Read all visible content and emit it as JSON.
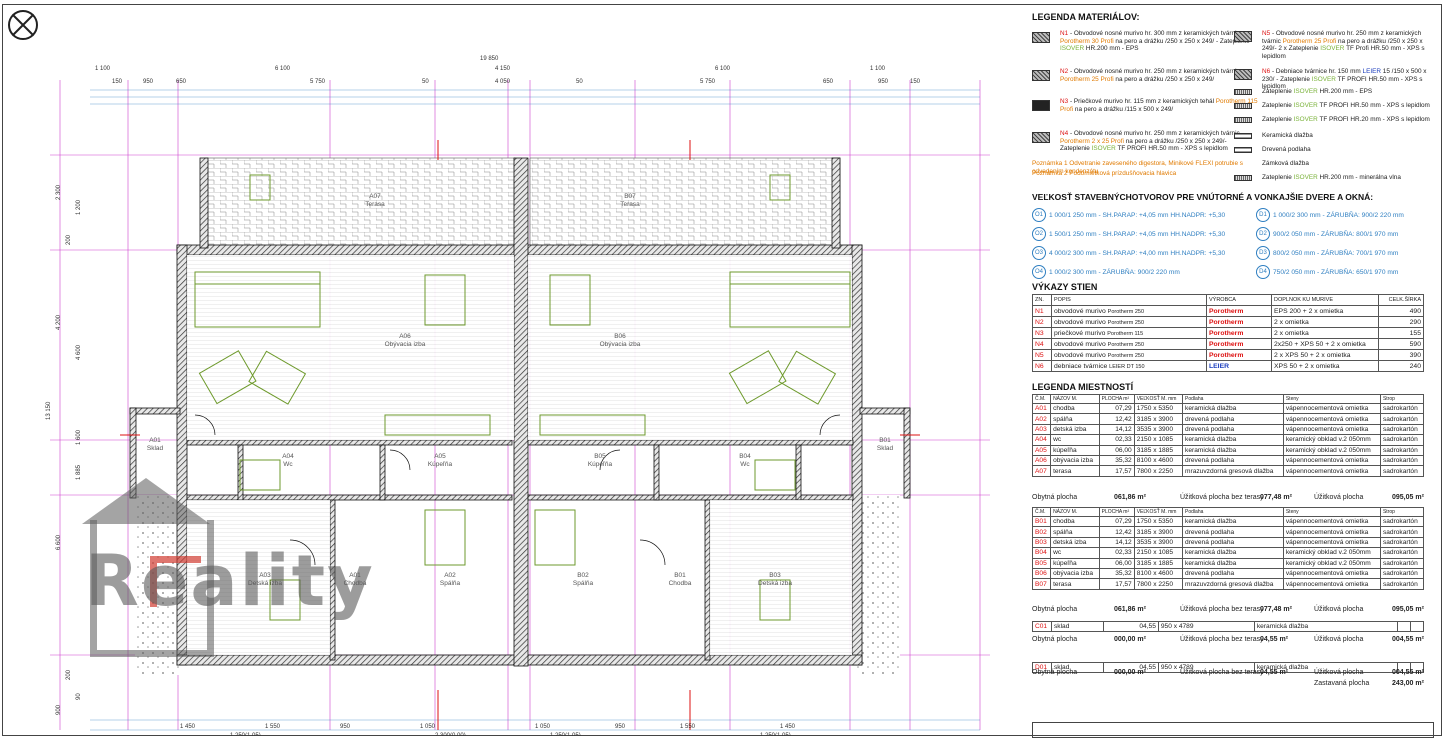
{
  "drawing": {
    "dims_top": [
      "19 850",
      "1 100",
      "6 100",
      "4 150",
      "6 100",
      "1 100",
      "150",
      "950",
      "650",
      "5 750",
      "50",
      "4 050",
      "50",
      "5 750",
      "650",
      "950",
      "150"
    ],
    "dims_left": [
      "2 300",
      "200",
      "1 200",
      "4 200",
      "4 600",
      "13 150",
      "1 600",
      "1 885",
      "6 600",
      "200",
      "90",
      "900"
    ],
    "dims_bottom": [
      "1 450",
      "1 550",
      "950",
      "1 050",
      "1 050",
      "950",
      "1 550",
      "1 450",
      "1 250(1,05)",
      "2 300(0,00)",
      "1 250(1,05)",
      "1 250(1,05)"
    ],
    "rooms": [
      {
        "code": "A07",
        "name": "Terasa"
      },
      {
        "code": "B07",
        "name": "Terasa"
      },
      {
        "code": "A06",
        "name": "Obývacia izba"
      },
      {
        "code": "B06",
        "name": "Obývacia izba"
      },
      {
        "code": "A05",
        "name": "Kúpeľňa"
      },
      {
        "code": "B05",
        "name": "Kúpeľňa"
      },
      {
        "code": "A04",
        "name": "Wc"
      },
      {
        "code": "B04",
        "name": "Wc"
      },
      {
        "code": "A01",
        "name": "Sklad"
      },
      {
        "code": "B01",
        "name": "Sklad"
      },
      {
        "code": "A03",
        "name": "Detská izba"
      },
      {
        "code": "B03",
        "name": "Detská izba"
      },
      {
        "code": "A02",
        "name": "Spálňa"
      },
      {
        "code": "B02",
        "name": "Spálňa"
      },
      {
        "code": "A01",
        "name": "Chodba"
      },
      {
        "code": "B01",
        "name": "Chodba"
      }
    ],
    "watermark": "Reality"
  },
  "legend_materials": {
    "title": "LEGENDA MATERIÁLOV:",
    "items_left": [
      {
        "code": "N1",
        "text": "- Obvodové nosné murivo hr. 300 mm z keramických tvárnic Porotherm 30 Profi na pero a drážku /250 x 250 x 249/ - Zateplenie ISOVER HR.200 mm - EPS"
      },
      {
        "code": "N2",
        "text": "- Obvodové nosné murivo hr. 250 mm z keramických tvárnic Porotherm 25 Profi na pero a drážku /250 x 250 x 249/"
      },
      {
        "code": "N3",
        "text": "- Priečkové murivo hr. 115 mm z keramických tehál Porotherm 115 Profi na pero a drážku /115 x 500 x 249/"
      },
      {
        "code": "N4",
        "text": "- Obvodové nosné murivo hr. 250 mm z keramických tvárnic Porotherm 2 x 25 Profi na pero a drážku /250 x 250 x 249/- Zateplenie ISOVER TF PROFI HR.50 mm - XPS s lepidlom"
      }
    ],
    "notes": [
      {
        "label": "Poznámka 1",
        "text": "Odvetranie zaveseného digestora, Minikové FLEXI potrubie s odvedením kondenzátu"
      },
      {
        "label": "Poznámka 2",
        "text": "Podomietková prízdušňovacia hlavica"
      }
    ],
    "items_right": [
      {
        "code": "N5",
        "text": "- Obvodové nosné murivo hr. 250 mm z keramických tvárnic Porotherm 25 Profi na pero a drážku /250 x 250 x 249/- 2 x Zateplenie ISOVER TF Profi HR.50 mm - XPS s lepidlom"
      },
      {
        "code": "N6",
        "text": "- Debniace tvárnice hr. 150 mm LEIER 15 /150 x 500 x 230/ - Zateplenie ISOVER TF PROFI HR.50 mm - XPS s lepidlom"
      },
      {
        "code": "",
        "text": "Zateplenie ISOVER HR.200 mm - EPS"
      },
      {
        "code": "",
        "text": "Zateplenie ISOVER TF PROFI HR.50 mm - XPS s lepidlom"
      },
      {
        "code": "",
        "text": "Zateplenie ISOVER TF PROFI HR.20 mm - XPS s lepidlom"
      },
      {
        "code": "",
        "text": "Keramická dlažba"
      },
      {
        "code": "",
        "text": "Drevená podlaha"
      },
      {
        "code": "",
        "text": "Zámková dlažba"
      },
      {
        "code": "",
        "text": "Zateplenie ISOVER HR.200 mm - minerálna vlna"
      }
    ]
  },
  "openings": {
    "title": "VEĽKOSŤ STAVEBNÝCHOTVOROV  PRE VNÚTORNÉ A VONKAJŠIE DVERE A OKNÁ:",
    "left": [
      {
        "id": "O1",
        "text": "1 000/1 250 mm  -  SH.PARAP:  +4,05 mm HH.NADPR: +5,30"
      },
      {
        "id": "O2",
        "text": "1 500/1 250 mm  -  SH.PARAP:  +4,05 mm HH.NADPR: +5,30"
      },
      {
        "id": "O3",
        "text": "4 000/2 300 mm  -  SH.PARAP:  +4,00 mm HH.NADPR: +5,30"
      },
      {
        "id": "O4",
        "text": "1 000/2 300 mm  -  ZÁRUBŇA:  900/2 220 mm"
      }
    ],
    "right": [
      {
        "id": "D1",
        "text": "1 000/2 300 mm  -  ZÁRUBŇA:  900/2 220 mm"
      },
      {
        "id": "D2",
        "text": "900/2 050 mm  -  ZÁRUBŇA:  800/1 970 mm"
      },
      {
        "id": "D3",
        "text": "800/2 050 mm  -  ZÁRUBŇA:  700/1 970 mm"
      },
      {
        "id": "D4",
        "text": "750/2 050 mm  -  ZÁRUBŇA:  650/1 970 mm"
      }
    ]
  },
  "walls": {
    "title": "VÝKAZY STIEN",
    "headers": [
      "ZN.",
      "POPIS",
      "VÝROBCA",
      "DOPLNOK KU MURIVE",
      "CELK.ŠÍRKA"
    ],
    "rows": [
      {
        "zn": "N1",
        "popis": "obvodové murivo",
        "typ": "Porotherm 250",
        "vyrobca": "Porotherm",
        "doplnok": "EPS 200 + 2 x omietka",
        "sirka": "490"
      },
      {
        "zn": "N2",
        "popis": "obvodové murivo",
        "typ": "Porotherm 250",
        "vyrobca": "Porotherm",
        "doplnok": "2 x omietka",
        "sirka": "290"
      },
      {
        "zn": "N3",
        "popis": "priečkové murivo",
        "typ": "Porotherm 115",
        "vyrobca": "Porotherm",
        "doplnok": "2 x omietka",
        "sirka": "155"
      },
      {
        "zn": "N4",
        "popis": "obvodové murivo",
        "typ": "Porotherm 250",
        "vyrobca": "Porotherm",
        "doplnok": "2x250 + XPS 50 + 2 x omietka",
        "sirka": "590"
      },
      {
        "zn": "N5",
        "popis": "obvodové murivo",
        "typ": "Porotherm 250",
        "vyrobca": "Porotherm",
        "doplnok": "2 x XPS 50 + 2 x omietka",
        "sirka": "390"
      },
      {
        "zn": "N6",
        "popis": "debniace tvárnice",
        "typ": "LEIER DT 150",
        "vyrobca": "LEIER",
        "doplnok": "XPS 50 + 2 x omietka",
        "sirka": "240"
      }
    ]
  },
  "rooms_legend": {
    "title": "LEGENDA MIESTNOSTÍ",
    "headers": [
      "Č.M.",
      "NÁZOV M.",
      "PLOCHA m²",
      "VEĽKOSŤ M. mm",
      "Podlaha",
      "Steny",
      "Strop"
    ],
    "table_a": [
      [
        "A01",
        "chodba",
        "07,29",
        "1750 x 5350",
        "keramická dlažba",
        "vápennocementová omietka",
        "sadrokartón"
      ],
      [
        "A02",
        "spálňa",
        "12,42",
        "3185 x 3900",
        "drevená podlaha",
        "vápennocementová omietka",
        "sadrokartón"
      ],
      [
        "A03",
        "detská izba",
        "14,12",
        "3535 x 3900",
        "drevená podlaha",
        "vápennocementová omietka",
        "sadrokartón"
      ],
      [
        "A04",
        "wc",
        "02,33",
        "2150 x 1085",
        "keramická dlažba",
        "keramický obklad v.2 050mm",
        "sadrokartón"
      ],
      [
        "A05",
        "kúpeľňa",
        "06,00",
        "3185 x 1885",
        "keramická dlažba",
        "keramický obklad v.2 050mm",
        "sadrokartón"
      ],
      [
        "A06",
        "obývacia izba",
        "35,32",
        "8100 x 4600",
        "drevená podlaha",
        "vápennocementová omietka",
        "sadrokartón"
      ],
      [
        "A07",
        "terasa",
        "17,57",
        "7800 x 2250",
        "mrazuvzdorná gresová dlažba",
        "vápennocementová omietka",
        "sadrokartón"
      ]
    ],
    "sum_a": {
      "l1": "Obytná plocha",
      "v1": "061,86 m²",
      "l2": "Úžitková plocha bez terasy",
      "v2": "077,48 m²",
      "l3": "Úžitková plocha",
      "v3": "095,05 m²"
    },
    "table_b": [
      [
        "B01",
        "chodba",
        "07,29",
        "1750 x 5350",
        "keramická dlažba",
        "vápennocementová omietka",
        "sadrokartón"
      ],
      [
        "B02",
        "spálňa",
        "12,42",
        "3185 x 3900",
        "drevená podlaha",
        "vápennocementová omietka",
        "sadrokartón"
      ],
      [
        "B03",
        "detská izba",
        "14,12",
        "3535 x 3900",
        "drevená podlaha",
        "vápennocementová omietka",
        "sadrokartón"
      ],
      [
        "B04",
        "wc",
        "02,33",
        "2150 x 1085",
        "keramická dlažba",
        "keramický obklad v.2 050mm",
        "sadrokartón"
      ],
      [
        "B05",
        "kúpeľňa",
        "06,00",
        "3185 x 1885",
        "keramická dlažba",
        "keramický obklad v.2 050mm",
        "sadrokartón"
      ],
      [
        "B06",
        "obývacia izba",
        "35,32",
        "8100 x 4600",
        "drevená podlaha",
        "vápennocementová omietka",
        "sadrokartón"
      ],
      [
        "B07",
        "terasa",
        "17,57",
        "7800 x 2250",
        "mrazuvzdorná gresová dlažba",
        "vápennocementová omietka",
        "sadrokartón"
      ]
    ],
    "sum_b": {
      "l1": "Obytná plocha",
      "v1": "061,86 m²",
      "l2": "Úžitková plocha bez terasy",
      "v2": "077,48 m²",
      "l3": "Úžitková plocha",
      "v3": "095,05 m²"
    },
    "table_c": [
      [
        "C01",
        "sklad",
        "04,55",
        "950 x 4789",
        "keramická dlažba"
      ]
    ],
    "sum_c": {
      "l1": "Obytná plocha",
      "v1": "000,00 m²",
      "l2": "Úžitková plocha bez terasy",
      "v2": "04,55 m²",
      "l3": "Úžitková plocha",
      "v3": "004,55 m²"
    },
    "table_d": [
      [
        "D01",
        "sklad",
        "04,55",
        "950 x 4789",
        "keramická dlažba"
      ]
    ],
    "sum_d": {
      "l1": "Obytná plocha",
      "v1": "000,00 m²",
      "l2": "Úžitková plocha bez terasy",
      "v2": "04,55 m²",
      "l3": "Úžitková plocha",
      "v3": "004,55 m²",
      "l4": "Zastavaná plocha",
      "v4": "243,00 m²"
    }
  },
  "colors": {
    "accent": "#e07a00",
    "green": "#7ab23a",
    "magenta": "#c000c0",
    "blue": "#2f7fc1",
    "red": "#d11"
  }
}
